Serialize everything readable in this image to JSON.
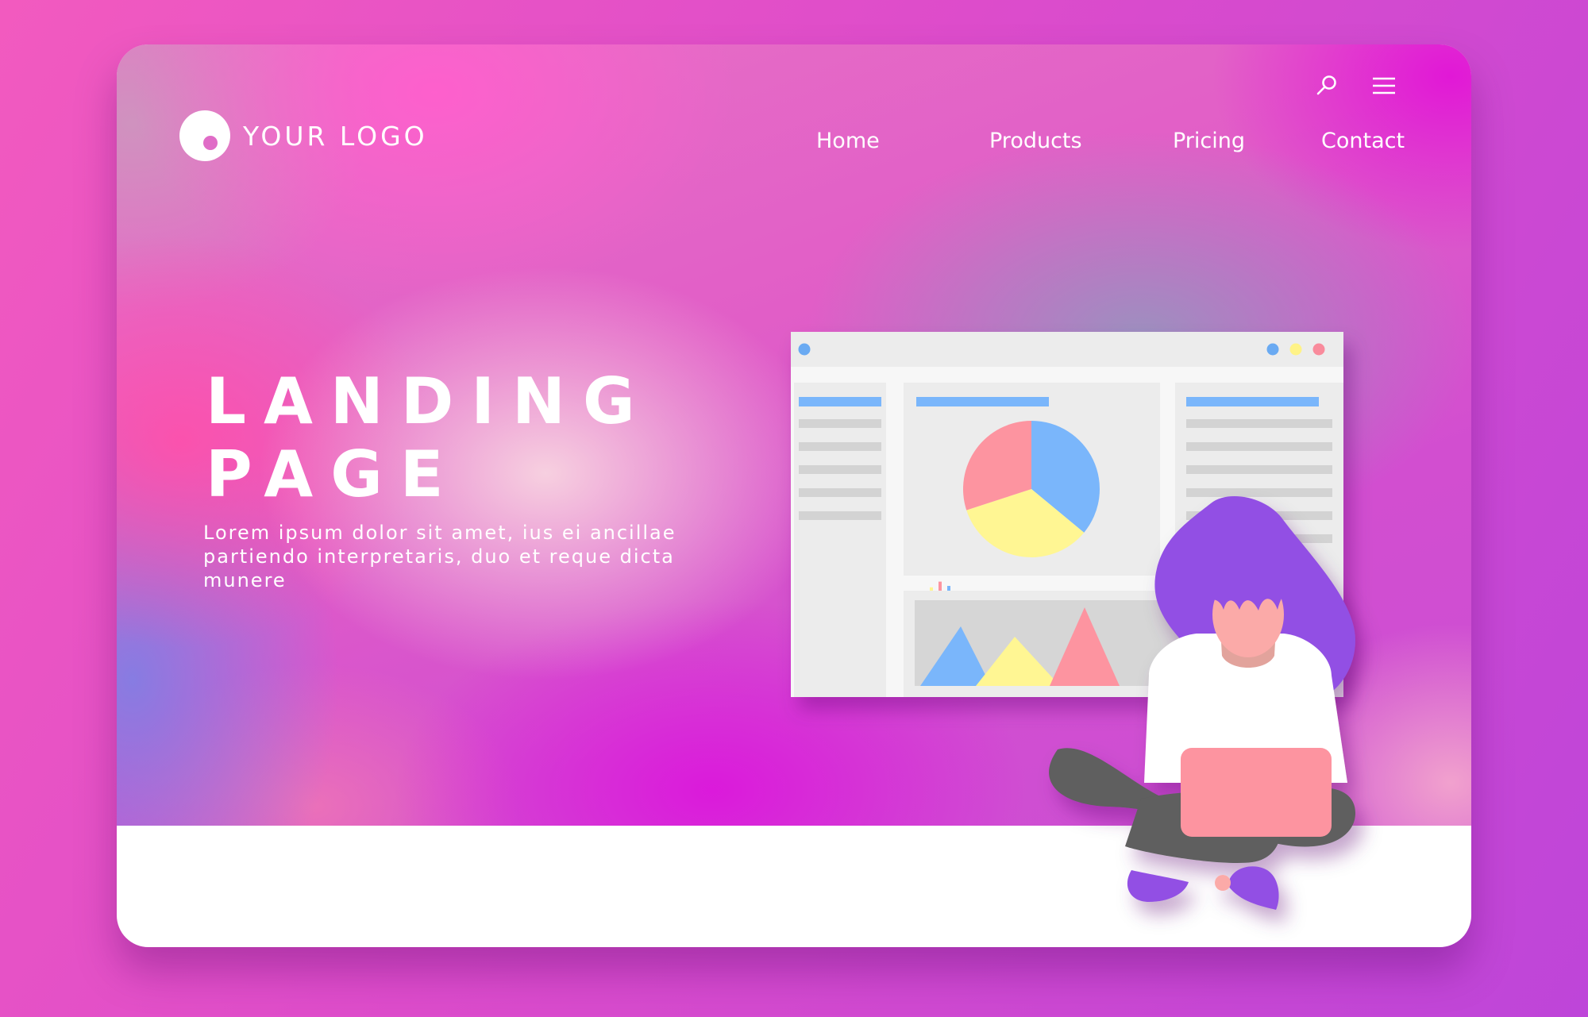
{
  "header": {
    "logo_text": "YOUR LOGO",
    "nav": [
      {
        "label": "Home"
      },
      {
        "label": "Products"
      },
      {
        "label": "Pricing"
      },
      {
        "label": "Contact"
      }
    ],
    "icons": [
      "search-icon",
      "hamburger-menu-icon"
    ]
  },
  "hero": {
    "headline_line1": "LANDING",
    "headline_line2": "PAGE",
    "body": "Lorem ipsum dolor sit amet, ius ei ancillae partiendo interpretaris, duo et reque dicta munere"
  },
  "illustration": {
    "dashboard": {
      "window_dots": [
        "#6aaaf2",
        "#fff387",
        "#f98b9c"
      ],
      "pie_colors": [
        "#7ab6fb",
        "#fff693",
        "#fd94a0"
      ],
      "pie_shares": [
        0.36,
        0.34,
        0.3
      ],
      "mini_bars": [
        0.45,
        0.7,
        0.9,
        0.75
      ],
      "mountains": [
        "#7ab6fb",
        "#fff693",
        "#fd94a0"
      ]
    },
    "colors": {
      "hair": "#9250e4",
      "skin": "#fbaaa8",
      "shirt": "#ffffff",
      "pants": "#5e5e5e",
      "laptop": "#fd94a0",
      "shoes": "#9250e4"
    }
  }
}
